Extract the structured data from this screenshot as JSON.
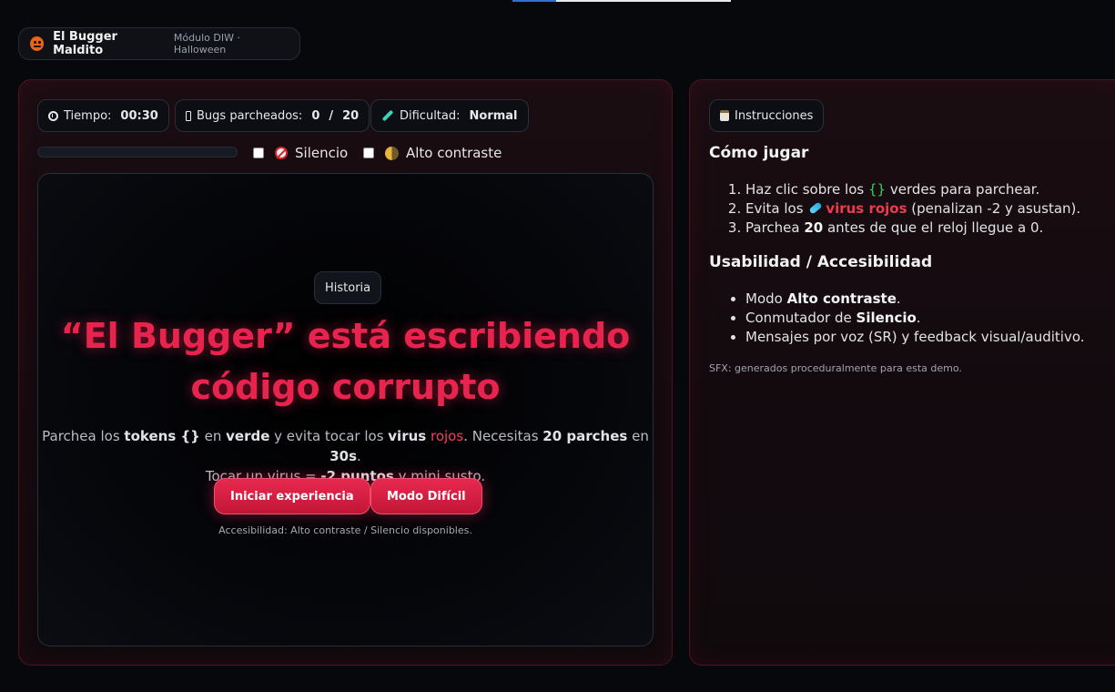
{
  "top_progress": {
    "fraction": 0.2
  },
  "brand": {
    "title": "El Bugger Maldito",
    "subtitle": "Módulo DIW · Halloween",
    "icon": "pumpkin-icon"
  },
  "stats": {
    "time_label": "Tiempo:",
    "time_value": "00:30",
    "bugs_label": "Bugs parcheados:",
    "bugs_value": "0",
    "bugs_sep": "/",
    "bugs_total": "20",
    "difficulty_label": "Dificultad:",
    "difficulty_value": "Normal"
  },
  "progress": {
    "fraction": 0
  },
  "toggles": {
    "silence_label": "Silencio",
    "contrast_label": "Alto contraste"
  },
  "stage": {
    "history_label": "Historia",
    "headline_line1": "“El Bugger” está escribiendo",
    "headline_line2": "código corrupto",
    "desc": {
      "p1": "Parchea los ",
      "tokens": "tokens {}",
      "p2": " en ",
      "verde": "verde",
      "p3": " y evita tocar los ",
      "virus": "virus",
      "p4": " ",
      "rojos": "rojos",
      "p5": ". Necesitas ",
      "parches": "20 parches",
      "p6": " en ",
      "secs": "30s",
      "p7": ".",
      "l2a": "Tocar un virus = ",
      "puntos": "-2 puntos",
      "l2b": " y mini susto."
    },
    "start_button": "Iniciar experiencia",
    "hard_button": "Modo Difícil",
    "accessibility_note": "Accesibilidad: Alto contraste / Silencio disponibles."
  },
  "instructions": {
    "chip_label": "Instrucciones",
    "how_title": "Cómo jugar",
    "steps": {
      "s1a": "Haz clic sobre los ",
      "s1b": "{}",
      "s1c": " verdes para parchear.",
      "s2a": "Evita los ",
      "s2b": "virus rojos",
      "s2c": " (penalizan -2 y asustan).",
      "s3a": "Parchea ",
      "s3b": "20",
      "s3c": " antes de que el reloj llegue a 0."
    },
    "usability_title": "Usabilidad / Accesibilidad",
    "usability": {
      "u1a": "Modo ",
      "u1b": "Alto contraste",
      "u1c": ".",
      "u2a": "Conmutador de ",
      "u2b": "Silencio",
      "u2c": ".",
      "u3": "Mensajes por voz (SR) y feedback visual/auditivo."
    },
    "sfx_note": "SFX: generados proceduralmente para esta demo."
  },
  "colors": {
    "accent": "#e8234e",
    "token_green": "#34d35f",
    "virus_red": "#ef3a4e"
  }
}
